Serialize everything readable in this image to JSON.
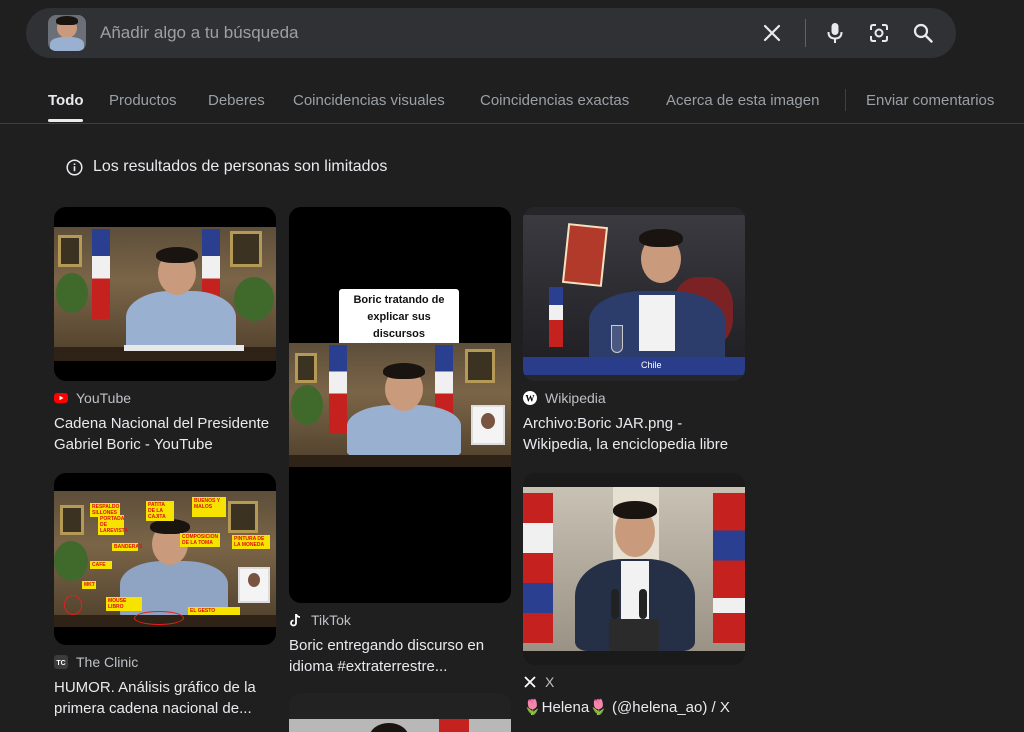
{
  "search": {
    "placeholder": "Añadir algo a tu búsqueda"
  },
  "tabs": [
    {
      "label": "Todo",
      "active": true
    },
    {
      "label": "Productos"
    },
    {
      "label": "Deberes"
    },
    {
      "label": "Coincidencias visuales"
    },
    {
      "label": "Coincidencias exactas"
    },
    {
      "label": "Acerca de esta imagen"
    },
    {
      "label": "Enviar comentarios"
    }
  ],
  "notice": {
    "text": "Los resultados de personas son limitados"
  },
  "results": [
    {
      "source": "YouTube",
      "title": "Cadena Nacional del Presidente Gabriel Boric - YouTube",
      "icon": "youtube-icon"
    },
    {
      "source": "TikTok",
      "title": "Boric entregando discurso en idioma #extraterrestre...",
      "icon": "tiktok-icon",
      "overlay": "Boric tratando de explicar sus discursos"
    },
    {
      "source": "Wikipedia",
      "title": "Archivo:Boric JAR.png - Wikipedia, la enciclopedia libre",
      "icon": "wikipedia-icon",
      "overlay": "Chile"
    },
    {
      "source": "The Clinic",
      "title": "HUMOR. Análisis gráfico de la primera cadena nacional de...",
      "icon": "theclinic-icon"
    },
    {
      "source": "X",
      "title": "🌷Helena🌷 (@helena_ao) / X",
      "icon": "x-icon"
    }
  ],
  "colors": {
    "background": "#1f1f1f",
    "searchbar": "#303134",
    "youtube_red": "#ff0000"
  }
}
